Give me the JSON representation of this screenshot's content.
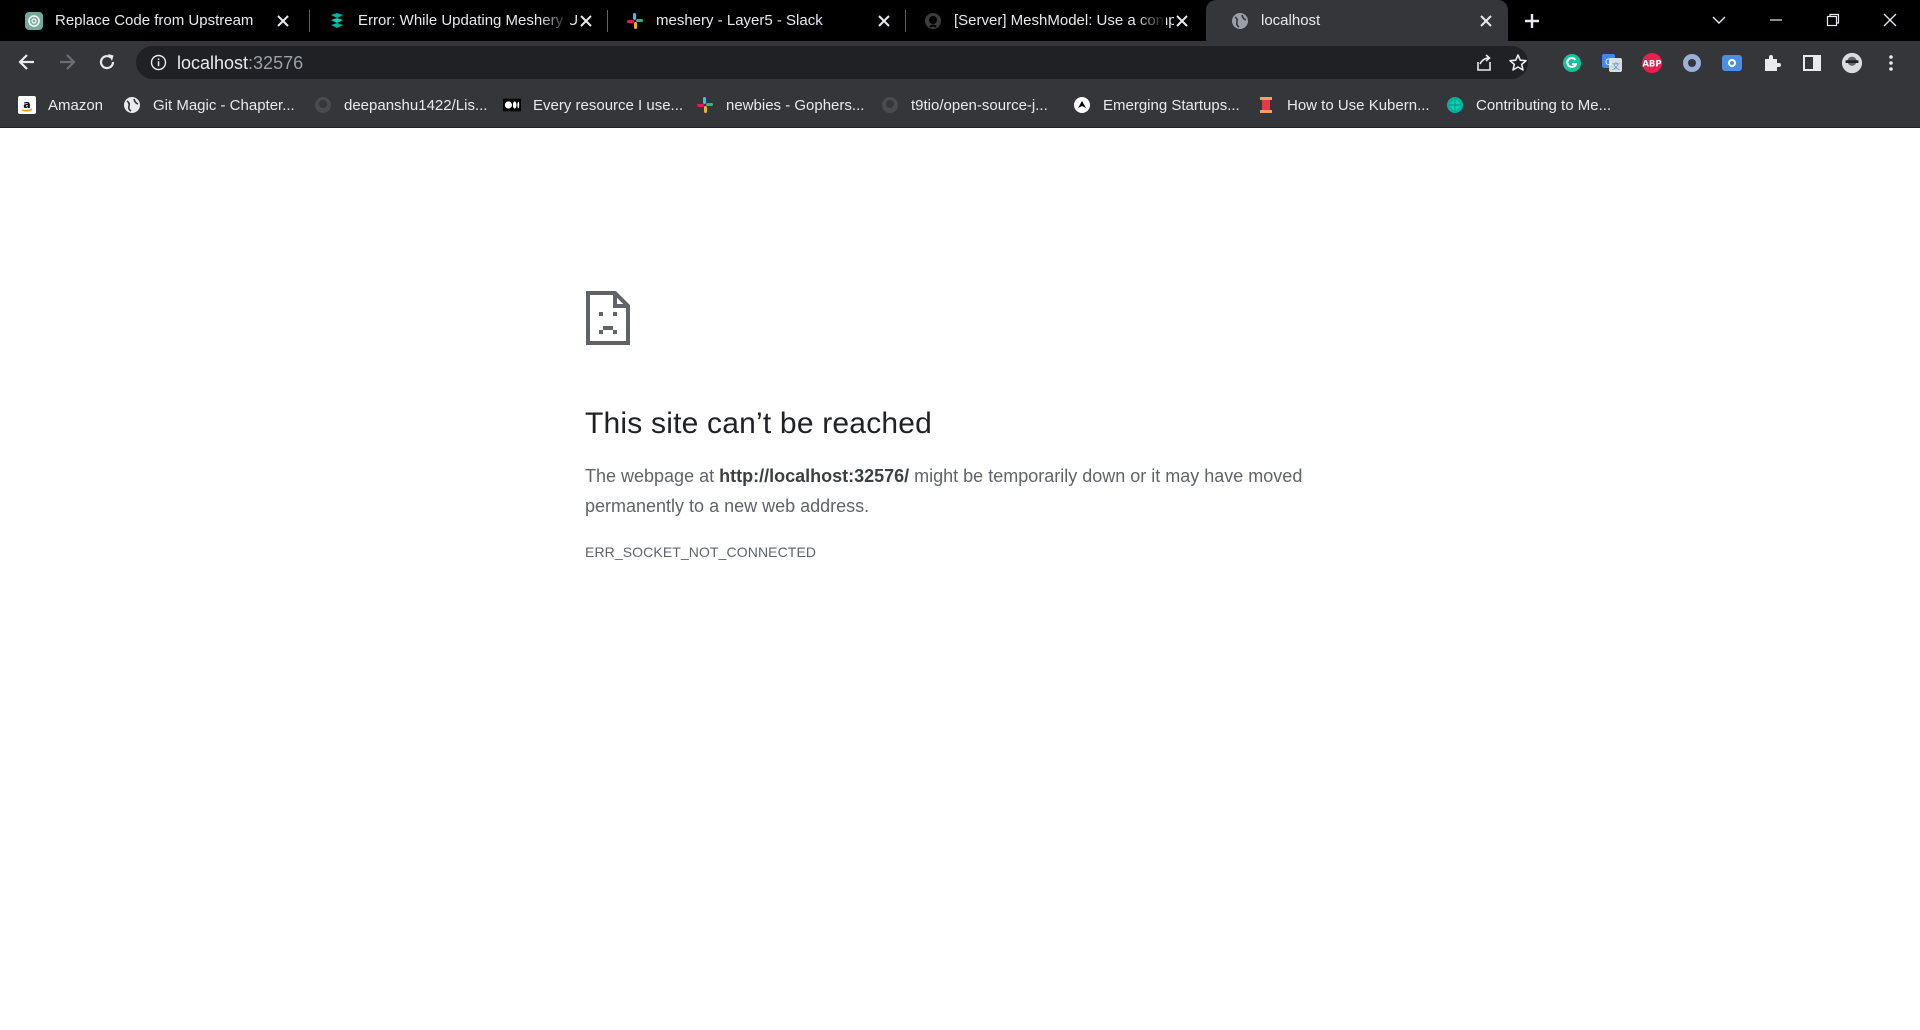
{
  "tabs": [
    {
      "title": "Replace Code from Upstream",
      "icon": "openai-icon"
    },
    {
      "title": "Error: While Updating Meshery U",
      "icon": "meshery-icon"
    },
    {
      "title": "meshery - Layer5 - Slack",
      "icon": "slack-icon"
    },
    {
      "title": "[Server] MeshModel: Use a comp",
      "icon": "github-icon"
    },
    {
      "title": "localhost",
      "icon": "globe-icon",
      "active": true
    }
  ],
  "address": {
    "host": "localhost",
    "port": ":32576"
  },
  "bookmarks": [
    {
      "label": "Amazon",
      "icon": "amazon-icon"
    },
    {
      "label": "Git Magic - Chapter...",
      "icon": "globe-icon"
    },
    {
      "label": "deepanshu1422/Lis...",
      "icon": "github-icon"
    },
    {
      "label": "Every resource I use...",
      "icon": "medium-icon"
    },
    {
      "label": "newbies - Gophers...",
      "icon": "slack-icon"
    },
    {
      "label": "t9tio/open-source-j...",
      "icon": "github-icon"
    },
    {
      "label": "Emerging Startups...",
      "icon": "arrow-circle-icon"
    },
    {
      "label": "How to Use Kubern...",
      "icon": "spool-icon"
    },
    {
      "label": "Contributing to Me...",
      "icon": "meshery-icon"
    }
  ],
  "extensions": {
    "abp_label": "ABP"
  },
  "error": {
    "title": "This site can’t be reached",
    "desc_prefix": "The webpage at ",
    "desc_url": "http://localhost:32576/",
    "desc_suffix": " might be temporarily down or it may have moved permanently to a new web address.",
    "code": "ERR_SOCKET_NOT_CONNECTED"
  },
  "colors": {
    "tabstrip_bg": "#000000",
    "toolbar_bg": "#35363a",
    "omnibox_bg": "#202124",
    "text_light": "#e8eaed",
    "error_title": "#202124",
    "error_text": "#5f6368"
  }
}
